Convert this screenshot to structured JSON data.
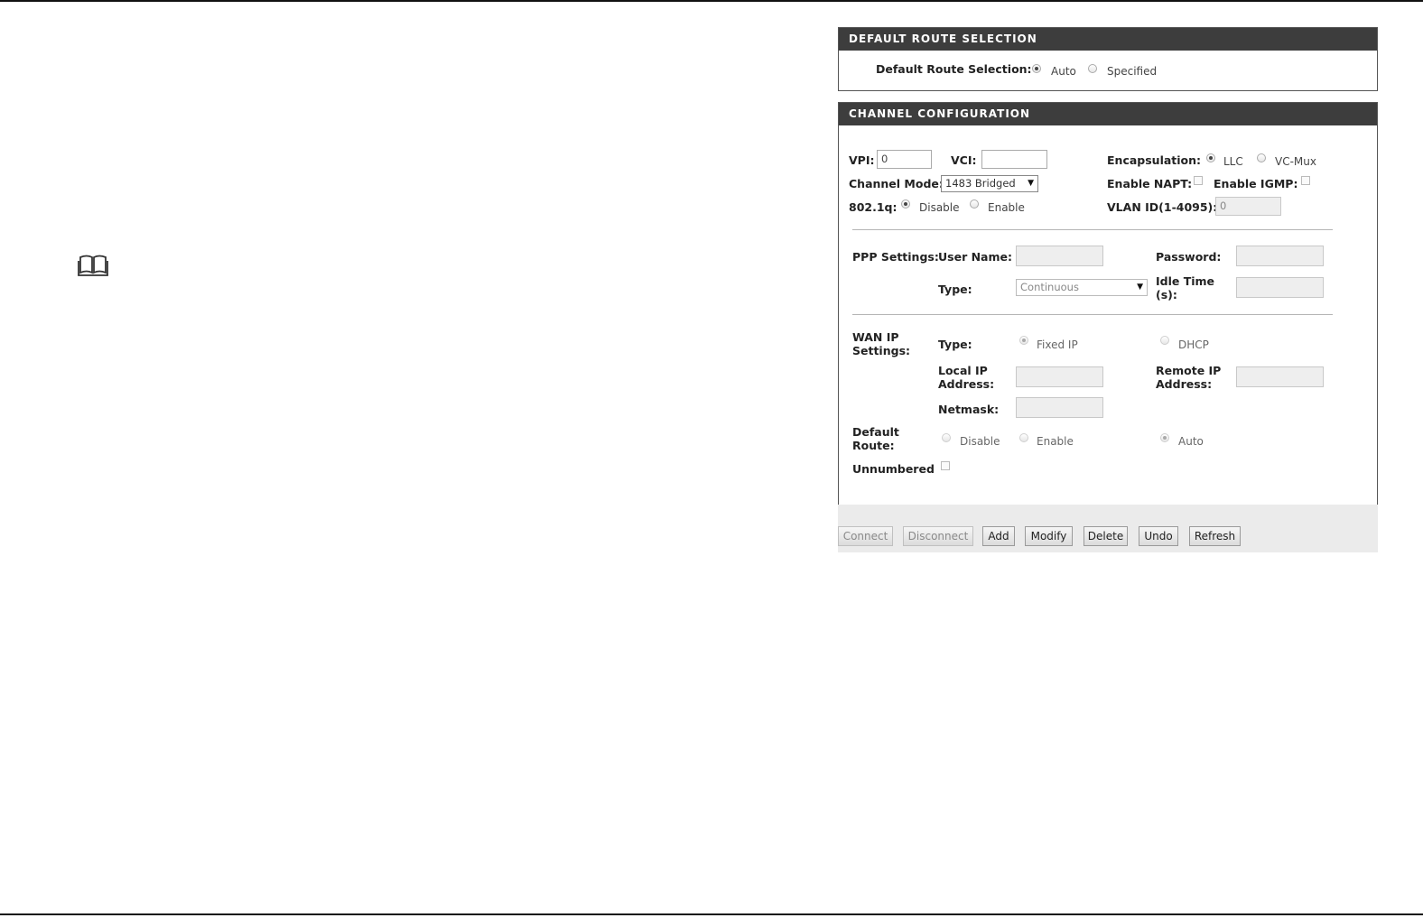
{
  "default_route_section": {
    "header": "DEFAULT ROUTE SELECTION",
    "label": "Default Route Selection:",
    "options": [
      {
        "label": "Auto",
        "selected": true
      },
      {
        "label": "Specified",
        "selected": false
      }
    ]
  },
  "channel_config": {
    "header": "CHANNEL CONFIGURATION",
    "vpi_label": "VPI:",
    "vpi_value": "0",
    "vci_label": "VCI:",
    "vci_value": "",
    "encapsulation_label": "Encapsulation:",
    "encapsulation_options": [
      {
        "label": "LLC",
        "selected": true
      },
      {
        "label": "VC-Mux",
        "selected": false
      }
    ],
    "channel_mode_label": "Channel Mode:",
    "channel_mode_value": "1483 Bridged",
    "enable_napt_label": "Enable NAPT:",
    "enable_igmp_label": "Enable IGMP:",
    "vlan_label": "802.1q:",
    "vlan_options": [
      {
        "label": "Disable",
        "selected": true
      },
      {
        "label": "Enable",
        "selected": false
      }
    ],
    "vlan_id_label": "VLAN ID(1-4095):",
    "vlan_id_value": "0"
  },
  "ppp_settings": {
    "section_label": "PPP Settings:",
    "username_label": "User Name:",
    "password_label": "Password:",
    "type_label": "Type:",
    "type_value": "Continuous",
    "idle_time_label_1": "Idle Time",
    "idle_time_label_2": "(s):"
  },
  "wan_ip": {
    "section_label_1": "WAN IP",
    "section_label_2": "Settings:",
    "type_label": "Type:",
    "type_options": [
      {
        "label": "Fixed IP",
        "selected": true
      },
      {
        "label": "DHCP",
        "selected": false
      }
    ],
    "local_ip_label_1": "Local IP",
    "local_ip_label_2": "Address:",
    "remote_ip_label_1": "Remote IP",
    "remote_ip_label_2": "Address:",
    "netmask_label": "Netmask:",
    "default_route_label_1": "Default",
    "default_route_label_2": "Route:",
    "default_route_options": [
      {
        "label": "Disable",
        "selected": false
      },
      {
        "label": "Enable",
        "selected": false
      },
      {
        "label": "Auto",
        "selected": true
      }
    ],
    "unnumbered_label": "Unnumbered"
  },
  "buttons": {
    "connect": "Connect",
    "disconnect": "Disconnect",
    "add": "Add",
    "modify": "Modify",
    "delete": "Delete",
    "undo": "Undo",
    "refresh": "Refresh"
  },
  "icons": {
    "note": "book-icon"
  }
}
